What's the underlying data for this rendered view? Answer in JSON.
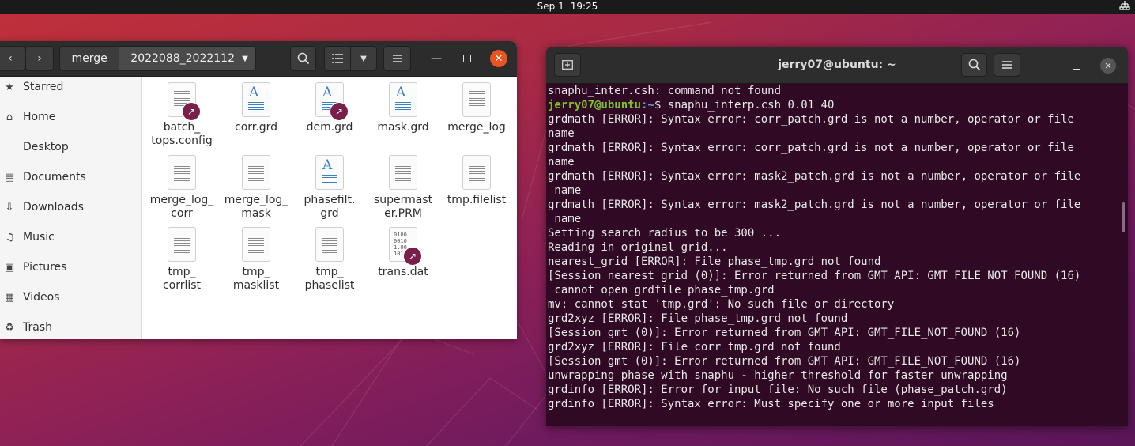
{
  "topbar": {
    "date": "Sep 1",
    "time": "19:25",
    "network_icon": "network-icon"
  },
  "files_app": {
    "path": {
      "parent": "merge",
      "current": "2022088_2022112"
    },
    "sidebar": [
      {
        "label": "Starred",
        "icon": "star-icon"
      },
      {
        "label": "Home",
        "icon": "home-icon"
      },
      {
        "label": "Desktop",
        "icon": "desktop-icon"
      },
      {
        "label": "Documents",
        "icon": "documents-icon"
      },
      {
        "label": "Downloads",
        "icon": "downloads-icon"
      },
      {
        "label": "Music",
        "icon": "music-icon"
      },
      {
        "label": "Pictures",
        "icon": "pictures-icon"
      },
      {
        "label": "Videos",
        "icon": "videos-icon"
      },
      {
        "label": "Trash",
        "icon": "trash-icon"
      }
    ],
    "files": [
      {
        "name": "batch_\ntops.config",
        "kind": "text",
        "link": true
      },
      {
        "name": "corr.grd",
        "kind": "doc",
        "link": false
      },
      {
        "name": "dem.grd",
        "kind": "doc",
        "link": true
      },
      {
        "name": "mask.grd",
        "kind": "doc",
        "link": false
      },
      {
        "name": "merge_log",
        "kind": "text",
        "link": false
      },
      {
        "name": "merge_log_\ncorr",
        "kind": "text",
        "link": false
      },
      {
        "name": "merge_log_\nmask",
        "kind": "text",
        "link": false
      },
      {
        "name": "phasefilt.\ngrd",
        "kind": "doc",
        "link": false
      },
      {
        "name": "supermast\ner.PRM",
        "kind": "text",
        "link": false
      },
      {
        "name": "tmp.filelist",
        "kind": "text",
        "link": false
      },
      {
        "name": "tmp_\ncorrlist",
        "kind": "text",
        "link": false
      },
      {
        "name": "tmp_\nmasklist",
        "kind": "text",
        "link": false
      },
      {
        "name": "tmp_\nphaselist",
        "kind": "text",
        "link": false
      },
      {
        "name": "trans.dat",
        "kind": "binary",
        "link": true
      }
    ]
  },
  "terminal": {
    "title": "jerry07@ubuntu: ~",
    "prompt_user": "jerry07@ubuntu",
    "prompt_path": ":~",
    "prompt_symbol": "$ ",
    "command": "snaphu_interp.csh 0.01 40",
    "line_before": "snaphu_inter.csh: command not found",
    "output": [
      "grdmath [ERROR]: Syntax error: corr_patch.grd is not a number, operator or file",
      "name",
      "grdmath [ERROR]: Syntax error: corr_patch.grd is not a number, operator or file",
      "name",
      "grdmath [ERROR]: Syntax error: mask2_patch.grd is not a number, operator or file",
      " name",
      "grdmath [ERROR]: Syntax error: mask2_patch.grd is not a number, operator or file",
      " name",
      "Setting search radius to be 300 ...",
      "Reading in original grid...",
      "nearest_grid [ERROR]: File phase_tmp.grd not found",
      "[Session nearest_grid (0)]: Error returned from GMT API: GMT_FILE_NOT_FOUND (16)",
      " cannot open grdfile phase_tmp.grd",
      "mv: cannot stat 'tmp.grd': No such file or directory",
      "grd2xyz [ERROR]: File phase_tmp.grd not found",
      "[Session gmt (0)]: Error returned from GMT API: GMT_FILE_NOT_FOUND (16)",
      "grd2xyz [ERROR]: File corr_tmp.grd not found",
      "[Session gmt (0)]: Error returned from GMT API: GMT_FILE_NOT_FOUND (16)",
      "unwrapping phase with snaphu - higher threshold for faster unwrapping",
      "grdinfo [ERROR]: Error for input file: No such file (phase_patch.grd)",
      "grdinfo [ERROR]: Syntax error: Must specify one or more input files"
    ]
  },
  "colors": {
    "accent": "#e95420",
    "terminal_bg": "#300a24",
    "prompt_user": "#7ec22e",
    "prompt_path": "#6f9ed8"
  }
}
